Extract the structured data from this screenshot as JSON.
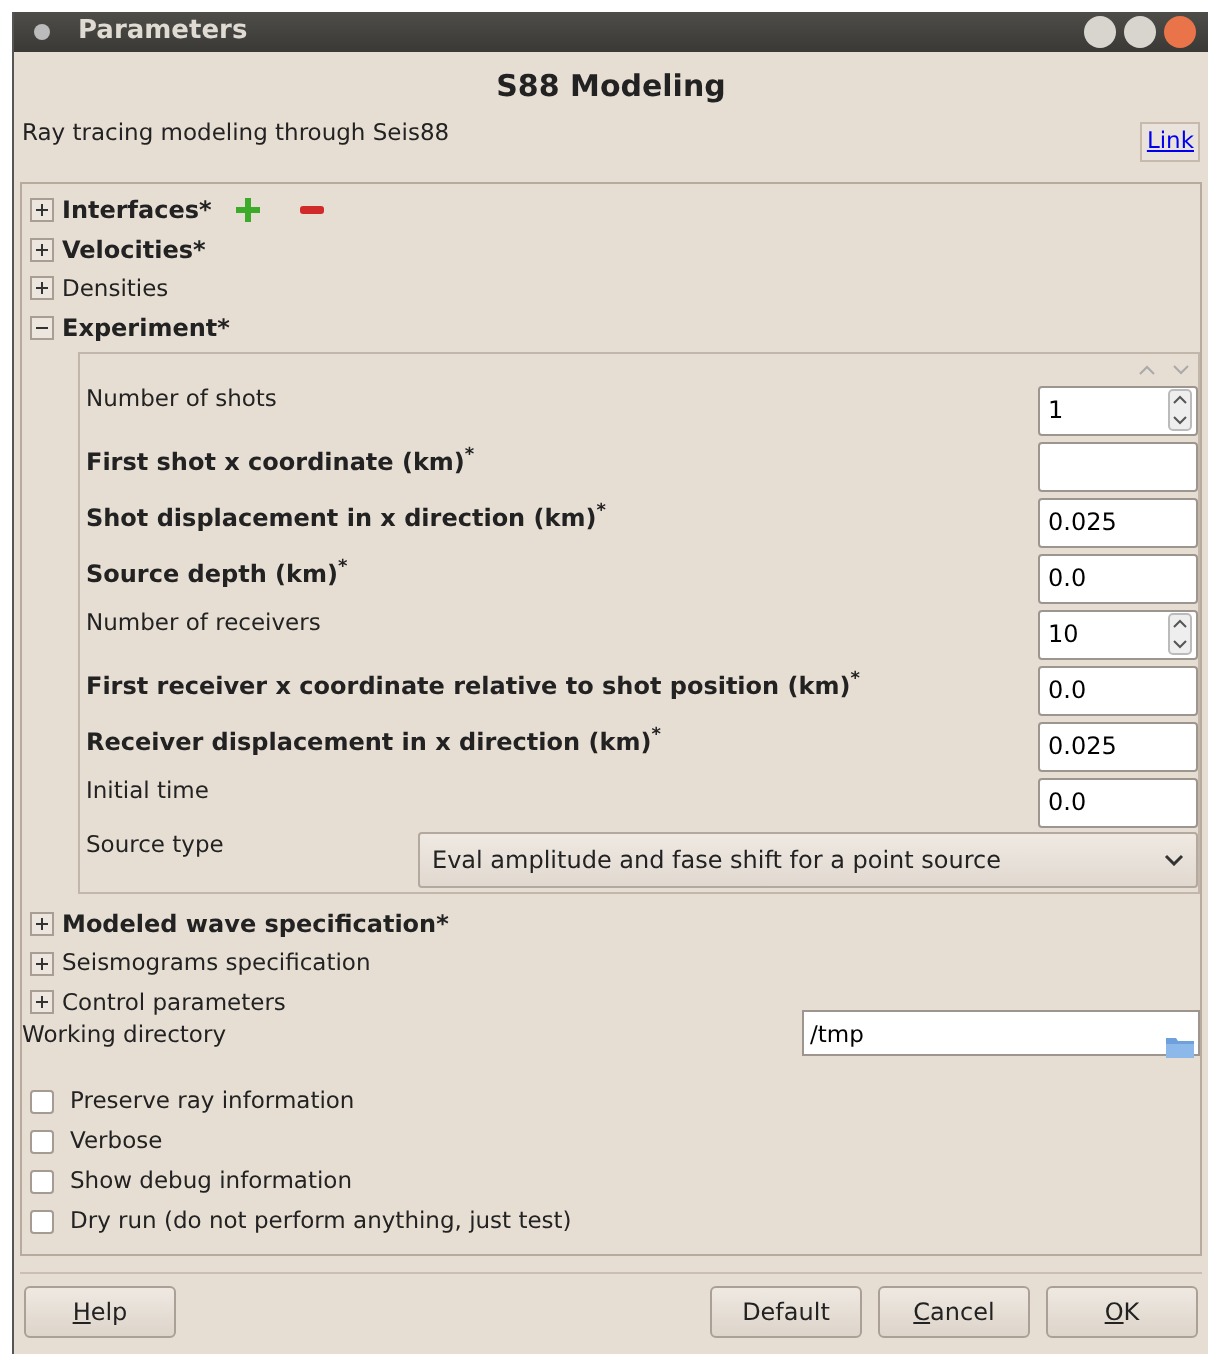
{
  "window": {
    "title": "Parameters"
  },
  "heading": "S88 Modeling",
  "description": "Ray tracing modeling through Seis88",
  "link": "Link",
  "sections_before": [
    {
      "label": "Interfaces*",
      "required": true,
      "expanded": false,
      "editable": true
    },
    {
      "label": "Velocities*",
      "required": true,
      "expanded": false
    },
    {
      "label": "Densities",
      "required": false,
      "expanded": false
    },
    {
      "label": "Experiment*",
      "required": true,
      "expanded": true
    }
  ],
  "experiment_fields": [
    {
      "label": "Number of shots",
      "required": false,
      "kind": "spin",
      "value": "1"
    },
    {
      "label": "First shot x coordinate (km)$^{*}$",
      "required": true,
      "kind": "text"
    },
    {
      "label": "Shot displacement in x direction (km)$^{*}$",
      "required": true,
      "kind": "text",
      "value": "0.025"
    },
    {
      "label": "Source depth (km)$^{*}$",
      "required": true,
      "kind": "text",
      "value": "0.0"
    },
    {
      "label": "Number of receivers",
      "required": false,
      "kind": "spin",
      "value": "10"
    },
    {
      "label": "First receiver x coordinate relative to shot position (km)$^{*}$",
      "required": true,
      "kind": "text",
      "value": "0.0"
    },
    {
      "label": "Receiver displacement in x direction (km)$^{*}$",
      "required": true,
      "kind": "text",
      "value": "0.025"
    },
    {
      "label": "Initial time",
      "required": false,
      "kind": "text",
      "value": "0.0"
    },
    {
      "label": "Source type",
      "required": false,
      "kind": "select",
      "value": "Eval amplitude and fase shift for a point source"
    }
  ],
  "sections_after": [
    {
      "label": "Modeled wave specification*",
      "required": true,
      "expanded": false
    },
    {
      "label": "Seismograms specification",
      "required": false,
      "expanded": false
    },
    {
      "label": "Control parameters",
      "required": false,
      "expanded": false
    }
  ],
  "working_directory": {
    "label": "Working directory",
    "value": "/tmp"
  },
  "options": [
    {
      "label": "Preserve ray information",
      "checked": false
    },
    {
      "label": "Verbose",
      "checked": false
    },
    {
      "label": "Show debug information",
      "checked": false
    },
    {
      "label": "Dry run (do not perform anything, just test)",
      "checked": false
    }
  ],
  "buttons_left": [
    {
      "accel": "H",
      "after": "elp"
    }
  ],
  "buttons_right": [
    {
      "before": "Default"
    },
    {
      "accel": "C",
      "after": "ancel"
    },
    {
      "accel": "O",
      "after": "K"
    }
  ]
}
